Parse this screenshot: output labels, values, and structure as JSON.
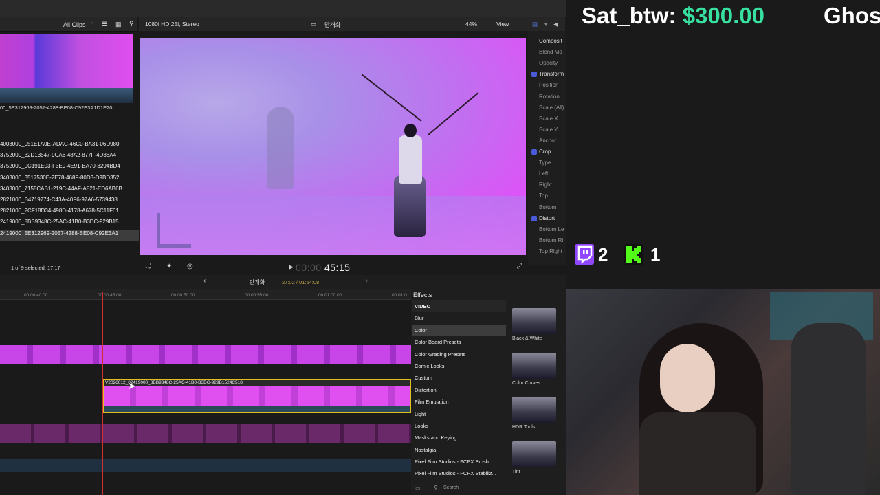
{
  "browser": {
    "filter_label": "All Clips",
    "clip_name": "00_5E312969-2057-4288-BE08-C92E3A1D1E20",
    "rows": [
      "4003000_051E1A0E-ADAC-46C0-BA31-06D980",
      "3752000_32D13547-9CA6-48A2-877F-4D38A4",
      "3752000_0C191E03-F3E9-4E91-BA70-3294BD4",
      "3403000_3517530E-2E78-468F-80D3-D9BD352",
      "3403000_7155CAB1-219C-44AF-A821-ED6AB6B",
      "2821000_B4719774-C43A-40F6-97A6-5739438",
      "2821000_2CF18D34-498D-4178-A678-5C11F01",
      "2419000_8BB9348C-25AC-41B0-B3DC-929B15",
      "2419000_5E312969-2057-4288-BE08-C92E3A1"
    ],
    "status": "1 of 9 selected, 17:17"
  },
  "viewer": {
    "format": "1080i HD 25i, Stereo",
    "project": "만개화",
    "zoom": "44%",
    "view_label": "View",
    "timecode_dim": "00:00",
    "timecode": "45:15"
  },
  "inspector": {
    "rows": [
      {
        "label": "Composit",
        "hdr": true,
        "check": false
      },
      {
        "label": "Blend Mo",
        "hdr": false,
        "check": false
      },
      {
        "label": "Opacity",
        "hdr": false,
        "check": false
      },
      {
        "label": "Transform",
        "hdr": true,
        "check": true
      },
      {
        "label": "Position",
        "hdr": false,
        "check": false
      },
      {
        "label": "Rotation",
        "hdr": false,
        "check": false
      },
      {
        "label": "Scale (All)",
        "hdr": false,
        "check": false
      },
      {
        "label": "Scale X",
        "hdr": false,
        "check": false
      },
      {
        "label": "Scale Y",
        "hdr": false,
        "check": false
      },
      {
        "label": "Anchor",
        "hdr": false,
        "check": false
      },
      {
        "label": "Crop",
        "hdr": true,
        "check": true
      },
      {
        "label": "Type",
        "hdr": false,
        "check": false
      },
      {
        "label": "Left",
        "hdr": false,
        "check": false
      },
      {
        "label": "Right",
        "hdr": false,
        "check": false
      },
      {
        "label": "Top",
        "hdr": false,
        "check": false
      },
      {
        "label": "Bottom",
        "hdr": false,
        "check": false
      },
      {
        "label": "Distort",
        "hdr": true,
        "check": true
      },
      {
        "label": "Bottom Le",
        "hdr": false,
        "check": false
      },
      {
        "label": "Bottom Ri",
        "hdr": false,
        "check": false
      },
      {
        "label": "Top Right",
        "hdr": false,
        "check": false
      }
    ]
  },
  "timeline": {
    "project": "만개화",
    "duration": "27:02 / 01:54:08",
    "ticks": [
      "00:00:40:00",
      "00:00:45:00",
      "00:00:50:00",
      "00:00:55:00",
      "00:01:00:00",
      "00:01:0"
    ],
    "selected_clip": "V2026012_02419000_8BB9348C-25AC-41B0-B3DC-929B1524C518"
  },
  "effects": {
    "title": "Effects",
    "categories": [
      "VIDEO",
      "Blur",
      "Color",
      "Color Board Presets",
      "Color Grading Presets",
      "Comic Looks",
      "Custom",
      "Distortion",
      "Film Emulation",
      "Light",
      "Looks",
      "Masks and Keying",
      "Nostalgia",
      "Pixel Film Studios - FCPX Brush",
      "Pixel Film Studios - FCPX Stabiliz..."
    ],
    "selected": "Color",
    "thumbs": [
      "Black & White",
      "Color Curves",
      "HDR Tools",
      "Tint"
    ],
    "search_placeholder": "Search"
  },
  "overlay": {
    "donor_name": "Sat_btw:",
    "donor_amount": "$300.00",
    "donor2": "Ghos",
    "twitch_count": "2",
    "kick_count": "1"
  },
  "colors": {
    "accent_green": "#38e0a0",
    "twitch": "#9146ff",
    "kick": "#53fc18",
    "clip_outline": "#e0c020"
  }
}
